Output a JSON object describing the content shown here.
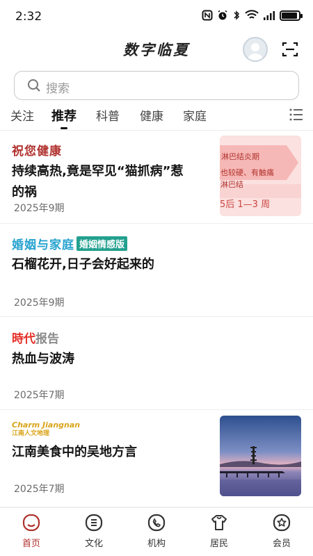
{
  "status_bar": {
    "time": "2:32",
    "battery_level": 0.9,
    "icons": [
      "nfc-icon",
      "alarm-icon",
      "bluetooth-icon",
      "wifi-icon",
      "signal-icon",
      "battery-icon"
    ]
  },
  "header": {
    "title": "数字临夏",
    "avatar_icon": "user-avatar-icon",
    "scan_icon": "scan-icon"
  },
  "search": {
    "placeholder": "搜索"
  },
  "tabs": {
    "items": [
      {
        "label": "关注",
        "active": false
      },
      {
        "label": "推荐",
        "active": true
      },
      {
        "label": "科普",
        "active": false
      },
      {
        "label": "健康",
        "active": false
      },
      {
        "label": "家庭",
        "active": false
      }
    ],
    "menu_icon": "list-menu-icon"
  },
  "feed": [
    {
      "brand": "祝您健康",
      "title_line1": "持续高热,竟是罕见“猫抓病”惹",
      "title_line2": "的祸",
      "date": "2025年9期",
      "thumb_lines": [
        "淋巴结炎期",
        "也较硬、有触痛",
        "淋巴结",
        "5后 1—3 周"
      ]
    },
    {
      "brand": "婚姻与家庭",
      "brand_tag": "婚姻情感版",
      "title": "石榴花开,日子会好起来的",
      "date": "2025年9期"
    },
    {
      "brand_a": "時代",
      "brand_b": "报告",
      "title": "热血与波涛",
      "date": "2025年7期"
    },
    {
      "brand_a": "Charm Jiangnan",
      "brand_b": "江南人文地理",
      "title": "江南美食中的吴地方言",
      "date": "2025年7期"
    }
  ],
  "bottom_nav": [
    {
      "label": "首页",
      "icon": "home-icon",
      "active": true
    },
    {
      "label": "文化",
      "icon": "culture-icon",
      "active": false
    },
    {
      "label": "机构",
      "icon": "phone-icon",
      "active": false
    },
    {
      "label": "居民",
      "icon": "resident-icon",
      "active": false
    },
    {
      "label": "会员",
      "icon": "member-icon",
      "active": false
    }
  ],
  "colors": {
    "accent": "#b0322e",
    "brand_teal": "#23a08f",
    "brand_blue": "#27a3cf"
  }
}
